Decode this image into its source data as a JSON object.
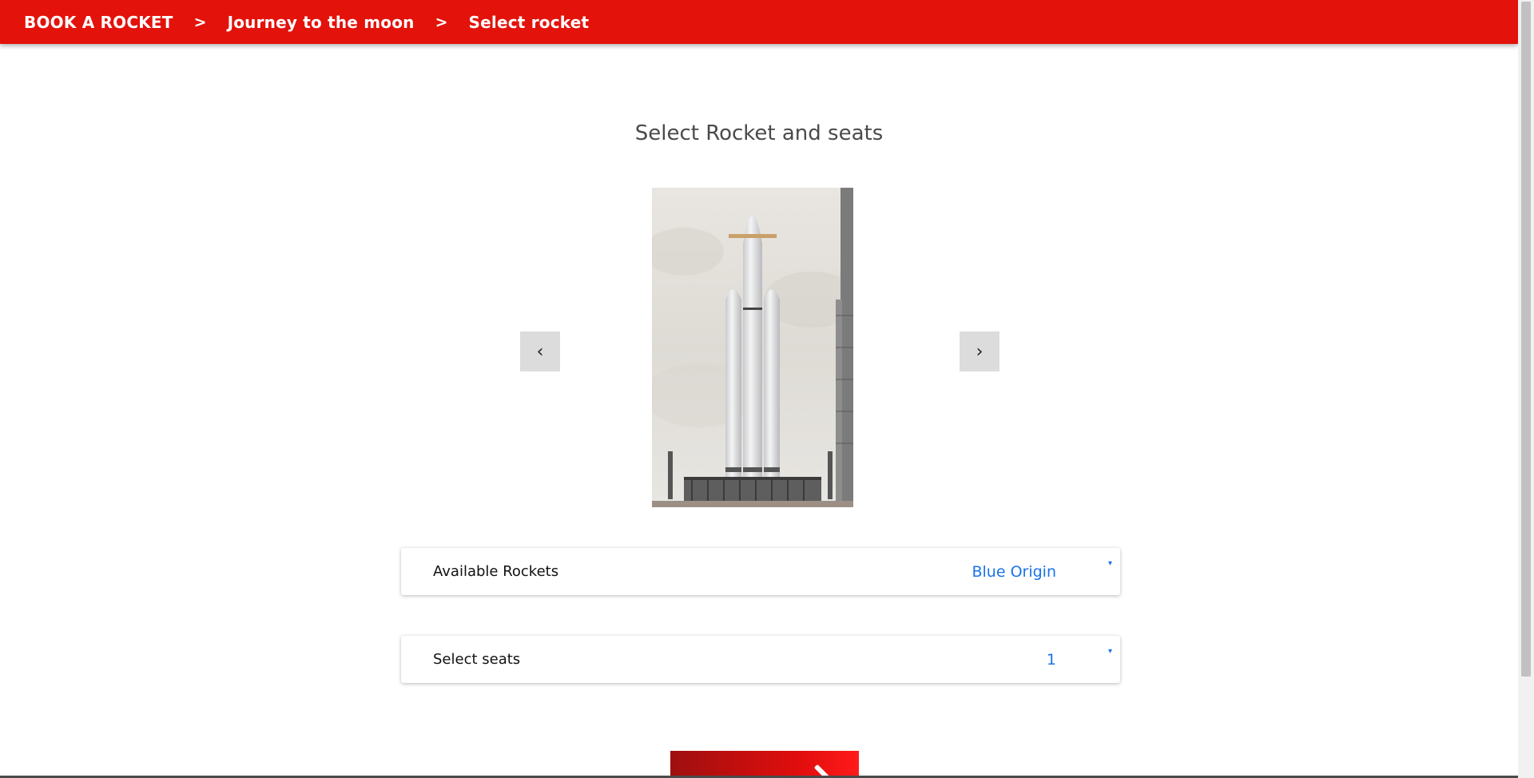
{
  "breadcrumb": {
    "items": [
      {
        "label": "BOOK A ROCKET"
      },
      {
        "label": "Journey to the moon"
      },
      {
        "label": "Select rocket"
      }
    ],
    "separator": ">"
  },
  "page": {
    "title": "Select Rocket and seats"
  },
  "carousel": {
    "prev_label": "‹",
    "next_label": "›",
    "image_subject": "Falcon Heavy rocket on launch pad"
  },
  "rocket_select": {
    "label": "Available Rockets",
    "value": "Blue Origin",
    "arrow": "▾"
  },
  "seats_select": {
    "label": "Select seats",
    "value": "1",
    "arrow": "▾"
  },
  "colors": {
    "header": "#e3120b",
    "accent_blue": "#1a73e8",
    "title_gray": "#4a4a4a"
  }
}
